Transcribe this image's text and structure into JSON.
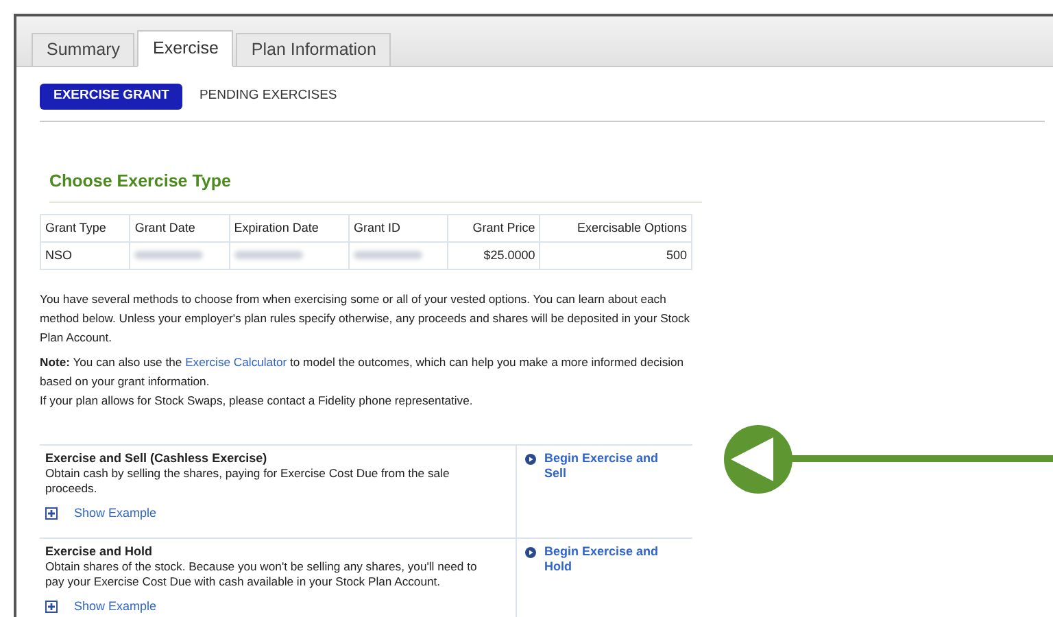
{
  "tabs": [
    {
      "label": "Summary",
      "selected": false
    },
    {
      "label": "Exercise",
      "selected": true
    },
    {
      "label": "Plan Information",
      "selected": false
    }
  ],
  "subtabs": [
    {
      "label": "EXERCISE GRANT",
      "selected": true
    },
    {
      "label": "PENDING EXERCISES",
      "selected": false
    }
  ],
  "section_title": "Choose Exercise Type",
  "table": {
    "columns": [
      "Grant Type",
      "Grant Date",
      "Expiration Date",
      "Grant ID",
      "Grant Price",
      "Exercisable Options"
    ],
    "rows": [
      [
        {
          "kind": "text",
          "text": "NSO"
        },
        {
          "kind": "redacted"
        },
        {
          "kind": "redacted"
        },
        {
          "kind": "redacted"
        },
        {
          "kind": "text",
          "text": "$25.0000"
        },
        {
          "kind": "text",
          "text": "500"
        }
      ]
    ]
  },
  "intro": "You have several methods to choose from when exercising some or all of your vested options. You can learn about each method below. Unless your employer's plan rules specify otherwise, any proceeds and shares will be deposited in your Stock Plan Account.",
  "note": {
    "before": "**Note:** You can also use the",
    "link": "Exercise Calculator",
    "after": "to model the outcomes, which can help you make a more informed decision based on your grant information."
  },
  "swap_note": "If your plan allows for Stock Swaps, please contact a Fidelity phone representative.",
  "methods": [
    {
      "title": "Exercise and Sell (Cashless Exercise)",
      "description": "Obtain cash by selling the shares, paying for Exercise Cost Due from the sale proceeds.",
      "example": "Show Example",
      "action": "Begin Exercise and Sell"
    },
    {
      "title": "Exercise and Hold",
      "description": "Obtain shares of the stock. Because you won't be selling any shares, you'll need to pay your Exercise Cost Due with cash available in your Stock Plan Account.",
      "example": "Show Example",
      "action": "Begin Exercise and Hold"
    }
  ]
}
